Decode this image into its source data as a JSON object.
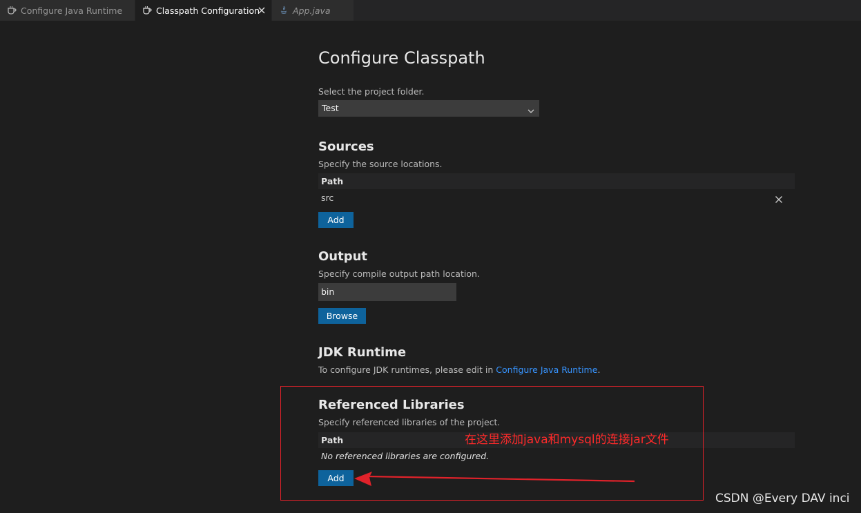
{
  "tabs": [
    {
      "label": "Configure Java Runtime",
      "icon": "java-cup-icon",
      "active": false
    },
    {
      "label": "Classpath Configuration",
      "icon": "java-cup-icon",
      "active": true
    },
    {
      "label": "App.java",
      "icon": "java-file-icon",
      "active": false
    }
  ],
  "page": {
    "title": "Configure Classpath",
    "project_label": "Select the project folder.",
    "project_value": "Test"
  },
  "sources": {
    "heading": "Sources",
    "description": "Specify the source locations.",
    "column_header": "Path",
    "rows": [
      "src"
    ],
    "add_label": "Add"
  },
  "output": {
    "heading": "Output",
    "description": "Specify compile output path location.",
    "value": "bin",
    "browse_label": "Browse"
  },
  "jdk": {
    "heading": "JDK Runtime",
    "description_prefix": "To configure JDK runtimes, please edit in ",
    "link_text": "Configure Java Runtime",
    "description_suffix": "."
  },
  "libraries": {
    "heading": "Referenced Libraries",
    "description": "Specify referenced libraries of the project.",
    "column_header": "Path",
    "empty_text": "No referenced libraries are configured.",
    "add_label": "Add"
  },
  "annotation": {
    "text": "在这里添加java和mysql的连接jar文件",
    "color": "#e0222a"
  },
  "watermark": "CSDN @Every DAV inci",
  "colors": {
    "background": "#1e1e1e",
    "button": "#0e639c",
    "link": "#3794ff",
    "annotation_red": "#e0222a"
  }
}
